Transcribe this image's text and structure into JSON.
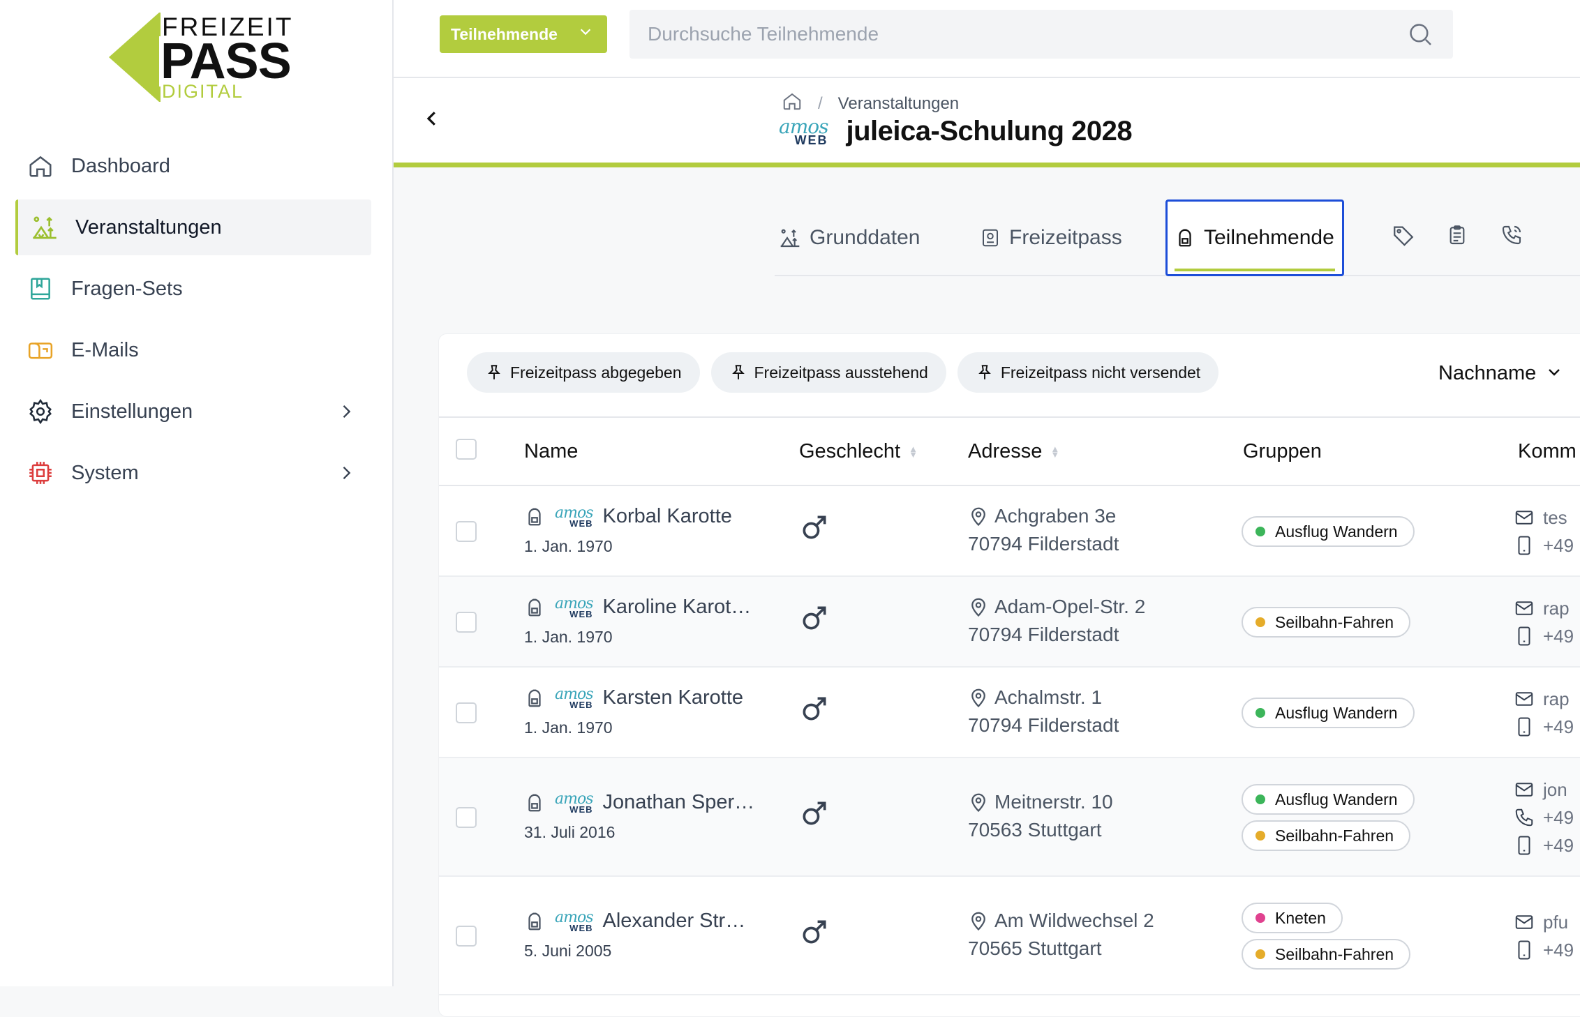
{
  "logo": {
    "line1": "FREIZEIT",
    "line2": "PASS",
    "line3": "DIGITAL"
  },
  "sidebar": {
    "items": [
      {
        "label": "Dashboard",
        "icon": "home-icon"
      },
      {
        "label": "Veranstaltungen",
        "icon": "camp-icon",
        "active": true
      },
      {
        "label": "Fragen-Sets",
        "icon": "book-icon"
      },
      {
        "label": "E-Mails",
        "icon": "mail-box-icon"
      },
      {
        "label": "Einstellungen",
        "icon": "gear-icon"
      },
      {
        "label": "System",
        "icon": "chip-icon"
      }
    ]
  },
  "topbar": {
    "scope_label": "Teilnehmende",
    "search_placeholder": "Durchsuche Teilnehmende"
  },
  "header": {
    "breadcrumb": "Veranstaltungen",
    "amos_top": "amos",
    "amos_bottom": "WEB",
    "title": "juleica-Schulung 2028"
  },
  "tabs": [
    {
      "label": "Grunddaten"
    },
    {
      "label": "Freizeitpass"
    },
    {
      "label": "Teilnehmende",
      "active": true
    }
  ],
  "filters": [
    "Freizeitpass abgegeben",
    "Freizeitpass ausstehend",
    "Freizeitpass nicht versendet"
  ],
  "sort": {
    "label": "Nachname"
  },
  "table": {
    "columns": [
      "Name",
      "Geschlecht",
      "Adresse",
      "Gruppen",
      "Komm"
    ],
    "gender_symbol": "♂",
    "rows": [
      {
        "name": "Korbal Karotte",
        "dob": "1. Jan. 1970",
        "street": "Achgraben 3e",
        "city": "70794 Filderstadt",
        "groups": [
          {
            "label": "Ausflug Wandern",
            "color": "#3cb55a"
          }
        ],
        "contact": [
          "tes",
          "+49"
        ]
      },
      {
        "name": "Karoline Karot…",
        "dob": "1. Jan. 1970",
        "street": "Adam-Opel-Str. 2",
        "city": "70794 Filderstadt",
        "groups": [
          {
            "label": "Seilbahn-Fahren",
            "color": "#e5ac2a"
          }
        ],
        "contact": [
          "rap",
          "+49"
        ]
      },
      {
        "name": "Karsten Karotte",
        "dob": "1. Jan. 1970",
        "street": "Achalmstr. 1",
        "city": "70794 Filderstadt",
        "groups": [
          {
            "label": "Ausflug Wandern",
            "color": "#3cb55a"
          }
        ],
        "contact": [
          "rap",
          "+49"
        ]
      },
      {
        "name": "Jonathan Sper…",
        "dob": "31. Juli 2016",
        "street": "Meitnerstr. 10",
        "city": "70563 Stuttgart",
        "groups": [
          {
            "label": "Ausflug Wandern",
            "color": "#3cb55a"
          },
          {
            "label": "Seilbahn-Fahren",
            "color": "#e5ac2a"
          }
        ],
        "contact": [
          "jon",
          "+49",
          "+49"
        ]
      },
      {
        "name": "Alexander Str…",
        "dob": "5. Juni 2005",
        "street": "Am Wildwechsel 2",
        "city": "70565 Stuttgart",
        "groups": [
          {
            "label": "Kneten",
            "color": "#e0428f"
          },
          {
            "label": "Seilbahn-Fahren",
            "color": "#e5ac2a"
          }
        ],
        "contact": [
          "pfu",
          "+49"
        ]
      }
    ]
  },
  "colors": {
    "brand": "#b2cc3e",
    "focus": "#1d4ed8"
  }
}
